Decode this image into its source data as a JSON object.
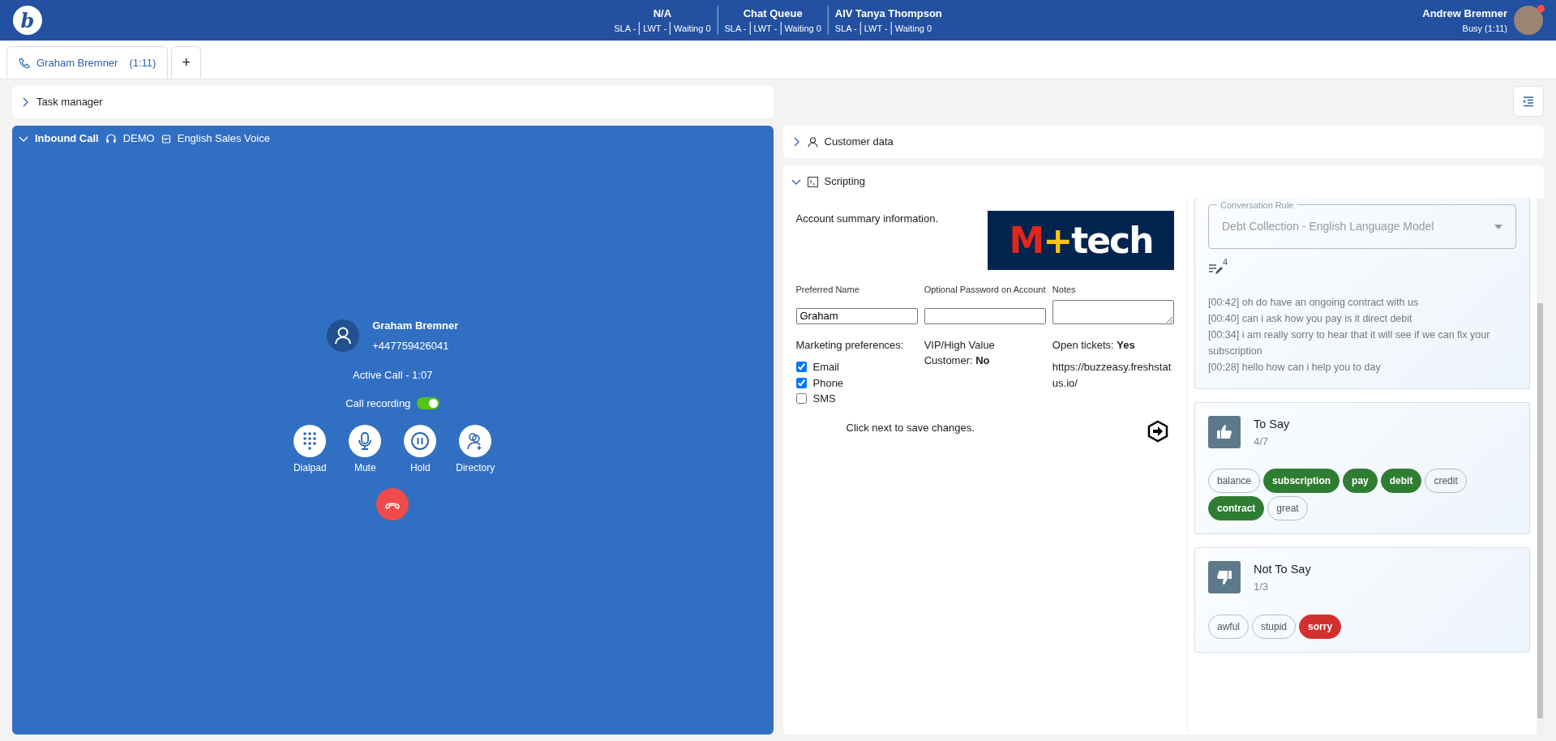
{
  "topbar": {
    "brand": "b",
    "queues": [
      {
        "name": "N/A",
        "stats": [
          "SLA -",
          "LWT -",
          "Waiting 0"
        ]
      },
      {
        "name": "Chat Queue",
        "stats": [
          "SLA -",
          "LWT -",
          "Waiting 0"
        ]
      },
      {
        "name": "AIV Tanya Thompson",
        "stats": [
          "SLA -",
          "LWT -",
          "Waiting 0"
        ]
      }
    ],
    "user": {
      "name": "Andrew Bremner",
      "status": "Busy (1:11)",
      "notification": true
    }
  },
  "tabs": [
    {
      "kind": "call",
      "label": "Graham Bremner",
      "timer": "(1:11)",
      "selected": true
    },
    {
      "kind": "add",
      "label": "+",
      "selected": false
    }
  ],
  "task_manager": {
    "title": "Task manager",
    "expanded": false
  },
  "call_panel": {
    "title": "Inbound Call",
    "expanded": true,
    "queue": "DEMO",
    "campaign": "English Sales Voice",
    "contact": {
      "name": "Graham Bremner",
      "phone": "+447759426041"
    },
    "call_state": "Active Call - 1:07",
    "recording": {
      "label": "Call recording",
      "on": true
    },
    "actions": [
      {
        "kind": "dialpad",
        "label": "Dialpad"
      },
      {
        "kind": "mute",
        "label": "Mute"
      },
      {
        "kind": "hold",
        "label": "Hold"
      },
      {
        "kind": "directory",
        "label": "Directory"
      }
    ]
  },
  "customer_data": {
    "title": "Customer data",
    "expanded": false
  },
  "scripting": {
    "title": "Scripting",
    "expanded": true,
    "intro": "Account summary information.",
    "logo": [
      {
        "text": "M",
        "color": "#e1261c"
      },
      {
        "text": "+",
        "color": "#ffc20e"
      },
      {
        "text": "tech",
        "color": "#ffffff"
      }
    ],
    "fields": [
      {
        "kind": "input",
        "label": "Preferred Name",
        "value": "Graham"
      },
      {
        "kind": "input",
        "label": "Optional Password on Account"
      },
      {
        "kind": "textarea",
        "label": "Notes"
      }
    ],
    "marketing": {
      "label": "Marketing preferences:",
      "options": [
        {
          "label": "Email",
          "checked": true
        },
        {
          "label": "Phone",
          "checked": true
        },
        {
          "label": "SMS",
          "checked": false
        }
      ]
    },
    "vip": "VIP/High Value Customer: **No**",
    "tickets": "Open tickets: **Yes**",
    "link": "https://buzzeasy.freshstatus.io/",
    "save_note": "Click next to save changes."
  },
  "assistant": {
    "rule": {
      "label": "Conversation Rule",
      "value": "Debt Collection - English Language Model"
    },
    "edits_count": "4",
    "transcript": [
      "[00:42] oh do have an ongoing contract with us",
      "[00:40] can i ask how you pay is it direct debit",
      "[00:34] i am really sorry to hear that it will see if we can fix your subscription",
      "[00:28] hello how can i help you to day"
    ],
    "cards": [
      {
        "kind": "positive",
        "title": "To Say",
        "count": "4/7",
        "words": [
          {
            "text": "balance",
            "hit": false
          },
          {
            "text": "subscription",
            "hit": true
          },
          {
            "text": "pay",
            "hit": true
          },
          {
            "text": "debit",
            "hit": true
          },
          {
            "text": "credit",
            "hit": false
          },
          {
            "text": "contract",
            "hit": true
          },
          {
            "text": "great",
            "hit": false
          }
        ]
      },
      {
        "kind": "negative",
        "title": "Not To Say",
        "count": "1/3",
        "words": [
          {
            "text": "awful",
            "hit": false
          },
          {
            "text": "stupid",
            "hit": false
          },
          {
            "text": "sorry",
            "hit": true
          }
        ]
      }
    ]
  }
}
